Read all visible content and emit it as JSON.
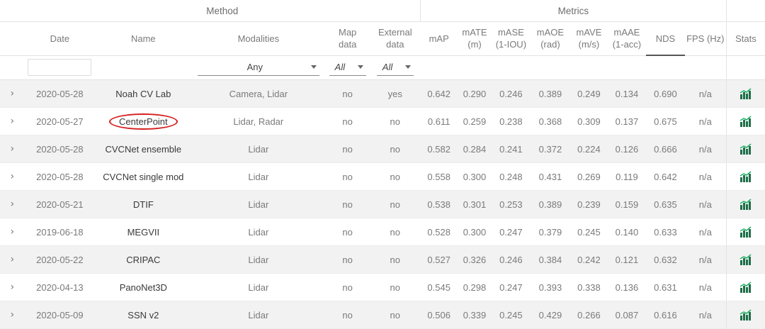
{
  "groups": {
    "method": "Method",
    "metrics": "Metrics"
  },
  "columns": {
    "date": "Date",
    "name": "Name",
    "modalities": "Modalities",
    "map_data": [
      "Map",
      "data"
    ],
    "external_data": [
      "External",
      "data"
    ],
    "map": "mAP",
    "mate": [
      "mATE",
      "(m)"
    ],
    "mase": [
      "mASE",
      "(1-IOU)"
    ],
    "maoe": [
      "mAOE",
      "(rad)"
    ],
    "mave": [
      "mAVE",
      "(m/s)"
    ],
    "maae": [
      "mAAE",
      "(1-acc)"
    ],
    "nds": "NDS",
    "fps": "FPS (Hz)",
    "stats": "Stats"
  },
  "filters": {
    "date_value": "",
    "modalities": "Any",
    "map_data": "All",
    "external_data": "All"
  },
  "sorted_column": "NDS",
  "highlighted_row": "CenterPoint",
  "icons": {
    "expand": "chevron-right-icon",
    "stats": "bar-chart-icon"
  },
  "colors": {
    "stats_icon": "#1f6f4a",
    "stats_accent": "#27b36b",
    "highlight_circle": "#d71f1f",
    "row_stripe": "#f2f2f2"
  },
  "rows": [
    {
      "date": "2020-05-28",
      "name": "Noah CV Lab",
      "modalities": "Camera, Lidar",
      "map_data": "no",
      "external_data": "yes",
      "map": "0.642",
      "mate": "0.290",
      "mase": "0.246",
      "maoe": "0.389",
      "mave": "0.249",
      "maae": "0.134",
      "nds": "0.690",
      "fps": "n/a"
    },
    {
      "date": "2020-05-27",
      "name": "CenterPoint",
      "modalities": "Lidar, Radar",
      "map_data": "no",
      "external_data": "no",
      "map": "0.611",
      "mate": "0.259",
      "mase": "0.238",
      "maoe": "0.368",
      "mave": "0.309",
      "maae": "0.137",
      "nds": "0.675",
      "fps": "n/a"
    },
    {
      "date": "2020-05-28",
      "name": "CVCNet ensemble",
      "modalities": "Lidar",
      "map_data": "no",
      "external_data": "no",
      "map": "0.582",
      "mate": "0.284",
      "mase": "0.241",
      "maoe": "0.372",
      "mave": "0.224",
      "maae": "0.126",
      "nds": "0.666",
      "fps": "n/a"
    },
    {
      "date": "2020-05-28",
      "name": "CVCNet single mod",
      "modalities": "Lidar",
      "map_data": "no",
      "external_data": "no",
      "map": "0.558",
      "mate": "0.300",
      "mase": "0.248",
      "maoe": "0.431",
      "mave": "0.269",
      "maae": "0.119",
      "nds": "0.642",
      "fps": "n/a"
    },
    {
      "date": "2020-05-21",
      "name": "DTIF",
      "modalities": "Lidar",
      "map_data": "no",
      "external_data": "no",
      "map": "0.538",
      "mate": "0.301",
      "mase": "0.253",
      "maoe": "0.389",
      "mave": "0.239",
      "maae": "0.159",
      "nds": "0.635",
      "fps": "n/a"
    },
    {
      "date": "2019-06-18",
      "name": "MEGVII",
      "modalities": "Lidar",
      "map_data": "no",
      "external_data": "no",
      "map": "0.528",
      "mate": "0.300",
      "mase": "0.247",
      "maoe": "0.379",
      "mave": "0.245",
      "maae": "0.140",
      "nds": "0.633",
      "fps": "n/a"
    },
    {
      "date": "2020-05-22",
      "name": "CRIPAC",
      "modalities": "Lidar",
      "map_data": "no",
      "external_data": "no",
      "map": "0.527",
      "mate": "0.326",
      "mase": "0.246",
      "maoe": "0.384",
      "mave": "0.242",
      "maae": "0.121",
      "nds": "0.632",
      "fps": "n/a"
    },
    {
      "date": "2020-04-13",
      "name": "PanoNet3D",
      "modalities": "Lidar",
      "map_data": "no",
      "external_data": "no",
      "map": "0.545",
      "mate": "0.298",
      "mase": "0.247",
      "maoe": "0.393",
      "mave": "0.338",
      "maae": "0.136",
      "nds": "0.631",
      "fps": "n/a"
    },
    {
      "date": "2020-05-09",
      "name": "SSN v2",
      "modalities": "Lidar",
      "map_data": "no",
      "external_data": "no",
      "map": "0.506",
      "mate": "0.339",
      "mase": "0.245",
      "maoe": "0.429",
      "mave": "0.266",
      "maae": "0.087",
      "nds": "0.616",
      "fps": "n/a"
    }
  ]
}
